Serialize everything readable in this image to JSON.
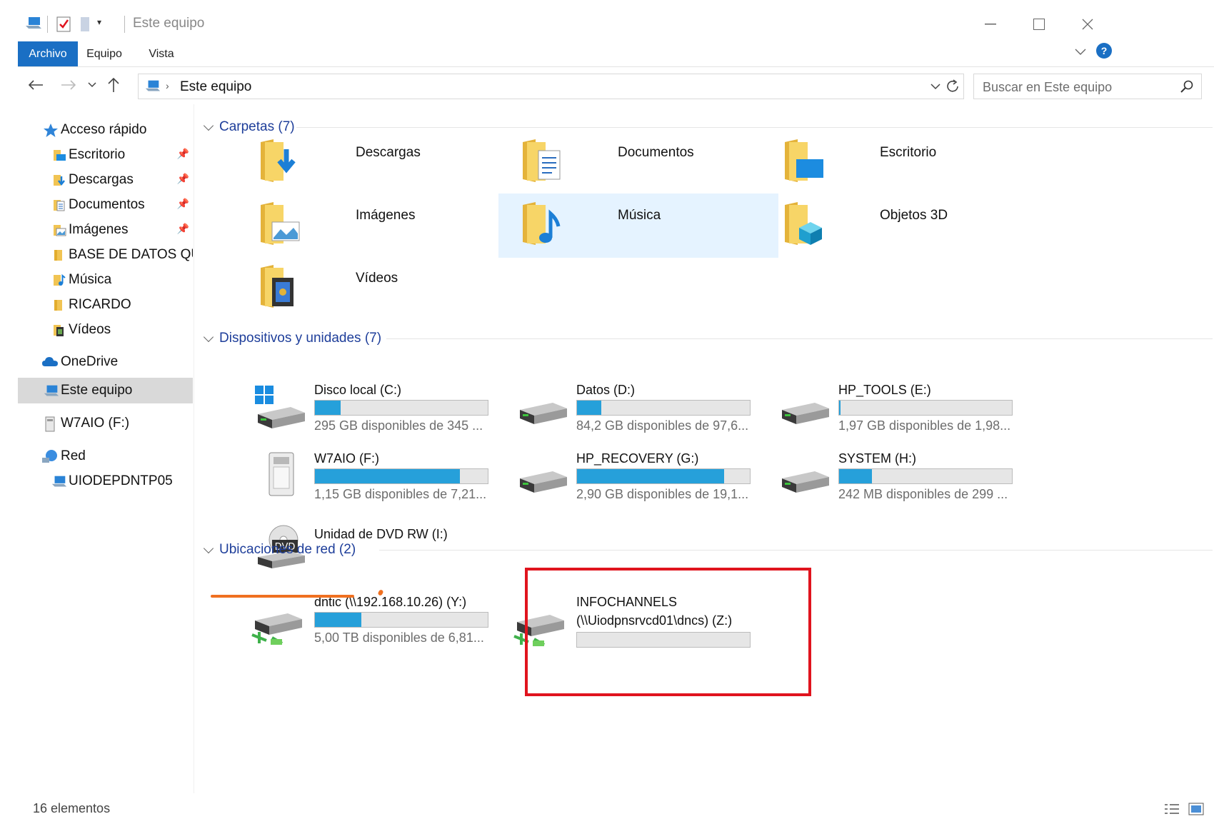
{
  "window": {
    "title": "Este equipo",
    "icons": [
      "computer-icon",
      "properties-icon",
      "new-folder-icon",
      "customize-icon"
    ]
  },
  "ribbon": {
    "tabs": [
      "Archivo",
      "Equipo",
      "Vista"
    ]
  },
  "address": {
    "path": "Este equipo",
    "search_placeholder": "Buscar en Este equipo"
  },
  "sidebar": {
    "items": [
      {
        "label": "Acceso rápido",
        "icon": "star-icon"
      },
      {
        "label": "Escritorio",
        "icon": "desktop-folder-icon",
        "pinned": true
      },
      {
        "label": "Descargas",
        "icon": "downloads-folder-icon",
        "pinned": true
      },
      {
        "label": "Documentos",
        "icon": "documents-folder-icon",
        "pinned": true
      },
      {
        "label": "Imágenes",
        "icon": "pictures-folder-icon",
        "pinned": true
      },
      {
        "label": "BASE DE DATOS QUITO",
        "icon": "folder-icon"
      },
      {
        "label": "Música",
        "icon": "music-folder-icon"
      },
      {
        "label": "RICARDO",
        "icon": "folder-icon"
      },
      {
        "label": "Vídeos",
        "icon": "videos-folder-icon"
      },
      {
        "label": "OneDrive",
        "icon": "cloud-icon"
      },
      {
        "label": "Este equipo",
        "icon": "computer-icon",
        "selected": true
      },
      {
        "label": "W7AIO (F:)",
        "icon": "usb-drive-icon"
      },
      {
        "label": "Red",
        "icon": "network-icon"
      },
      {
        "label": "UIODEPDNTP05",
        "icon": "computer-icon"
      }
    ]
  },
  "groups": {
    "folders": {
      "header": "Carpetas (7)",
      "items": [
        "Descargas",
        "Documentos",
        "Escritorio",
        "Imágenes",
        "Música",
        "Objetos 3D",
        "Vídeos"
      ]
    },
    "devices": {
      "header": "Dispositivos y unidades (7)",
      "items": [
        {
          "name": "Disco local (C:)",
          "free": "295 GB disponibles de 345 ...",
          "used": 0.15
        },
        {
          "name": "Datos (D:)",
          "free": "84,2 GB disponibles de 97,6...",
          "used": 0.14
        },
        {
          "name": "HP_TOOLS (E:)",
          "free": "1,97 GB disponibles de 1,98...",
          "used": 0.01
        },
        {
          "name": "W7AIO (F:)",
          "free": "1,15 GB disponibles de 7,21...",
          "used": 0.84
        },
        {
          "name": "HP_RECOVERY (G:)",
          "free": "2,90 GB disponibles de 19,1...",
          "used": 0.85
        },
        {
          "name": "SYSTEM (H:)",
          "free": "242 MB disponibles de 299 ...",
          "used": 0.19
        },
        {
          "name": "Unidad de DVD RW (I:)"
        }
      ]
    },
    "network": {
      "header": "Ubicaciones de red (2)",
      "items": [
        {
          "name": "dntic (\\\\192.168.10.26) (Y:)",
          "free": "5,00 TB disponibles de 6,81...",
          "used": 0.27
        },
        {
          "name_line1": "INFOCHANNELS",
          "name_line2": "(\\\\Uiodpnsrvcd01\\dncs) (Z:)",
          "used": 0
        }
      ]
    }
  },
  "status": {
    "count": "16 elementos"
  },
  "colors": {
    "accent": "#1a6fc4",
    "bar_fill": "#26a0da",
    "highlight": "#e0141e",
    "underline": "#f07020"
  }
}
